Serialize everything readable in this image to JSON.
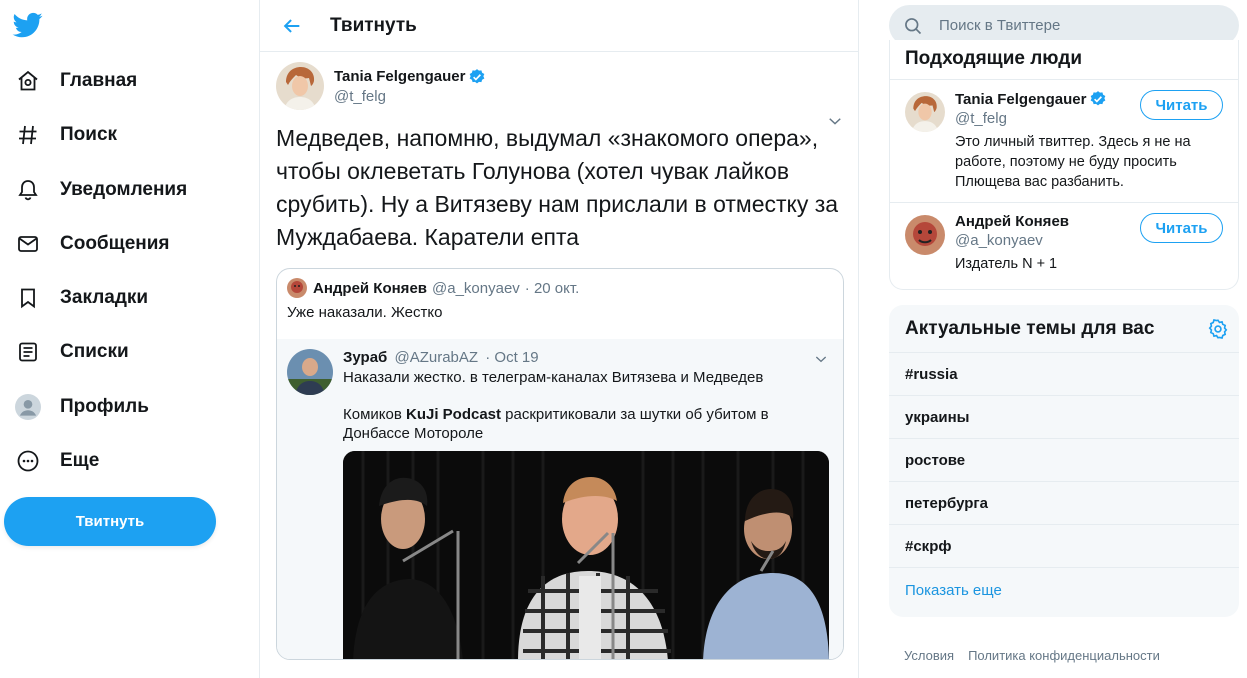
{
  "nav": {
    "items": [
      {
        "label": "Главная",
        "icon": "home-icon"
      },
      {
        "label": "Поиск",
        "icon": "hashtag-icon"
      },
      {
        "label": "Уведомления",
        "icon": "bell-icon"
      },
      {
        "label": "Сообщения",
        "icon": "envelope-icon"
      },
      {
        "label": "Закладки",
        "icon": "bookmark-icon"
      },
      {
        "label": "Списки",
        "icon": "list-icon"
      },
      {
        "label": "Профиль",
        "icon": "profile-icon"
      },
      {
        "label": "Еще",
        "icon": "more-icon"
      }
    ],
    "tweet_button": "Твитнуть"
  },
  "main": {
    "title": "Твитнуть",
    "tweet": {
      "author": "Tania Felgengauer",
      "handle": "@t_felg",
      "text": "Медведев, напомню, выдумал «знакомого опера», чтобы оклеветать Голунова (хотел чувак лайков срубить). Ну а Витязеву нам прислали в отместку за Муждабаева. Каратели епта"
    },
    "quote": {
      "author": "Андрей Коняев",
      "handle": "@a_konyaev",
      "date": "· 20 окт.",
      "text": "Уже наказали. Жестко",
      "nested": {
        "author": "Зураб",
        "handle": "@AZurabAZ",
        "date": "· Oct 19",
        "text1": "Наказали жестко. в телеграм-каналах Витязева и Медведев",
        "text2_before": "Комиков ",
        "text2_bold": "KuJi Podcast",
        "text2_after": " раскритиковали за шутки об убитом в Донбассе Мотороле"
      }
    }
  },
  "right": {
    "search_placeholder": "Поиск в Твиттере",
    "people_title": "Подходящие люди",
    "people": [
      {
        "name": "Tania Felgengauer",
        "handle": "@t_felg",
        "bio": "Это личный твиттер. Здесь я не на работе, поэтому не буду просить Плющева вас разбанить.",
        "follow": "Читать",
        "verified": true
      },
      {
        "name": "Андрей Коняев",
        "handle": "@a_konyaev",
        "bio": "Издатель N + 1",
        "follow": "Читать",
        "verified": false
      }
    ],
    "trends_title": "Актуальные темы для вас",
    "trends": [
      "#russia",
      "украины",
      "ростове",
      "петербурга",
      "#скрф"
    ],
    "show_more": "Показать еще",
    "footer": [
      "Условия",
      "Политика конфиденциальности"
    ]
  },
  "colors": {
    "accent": "#1da1f2",
    "text": "#14171a",
    "muted": "#657786",
    "border": "#e6ecf0"
  }
}
